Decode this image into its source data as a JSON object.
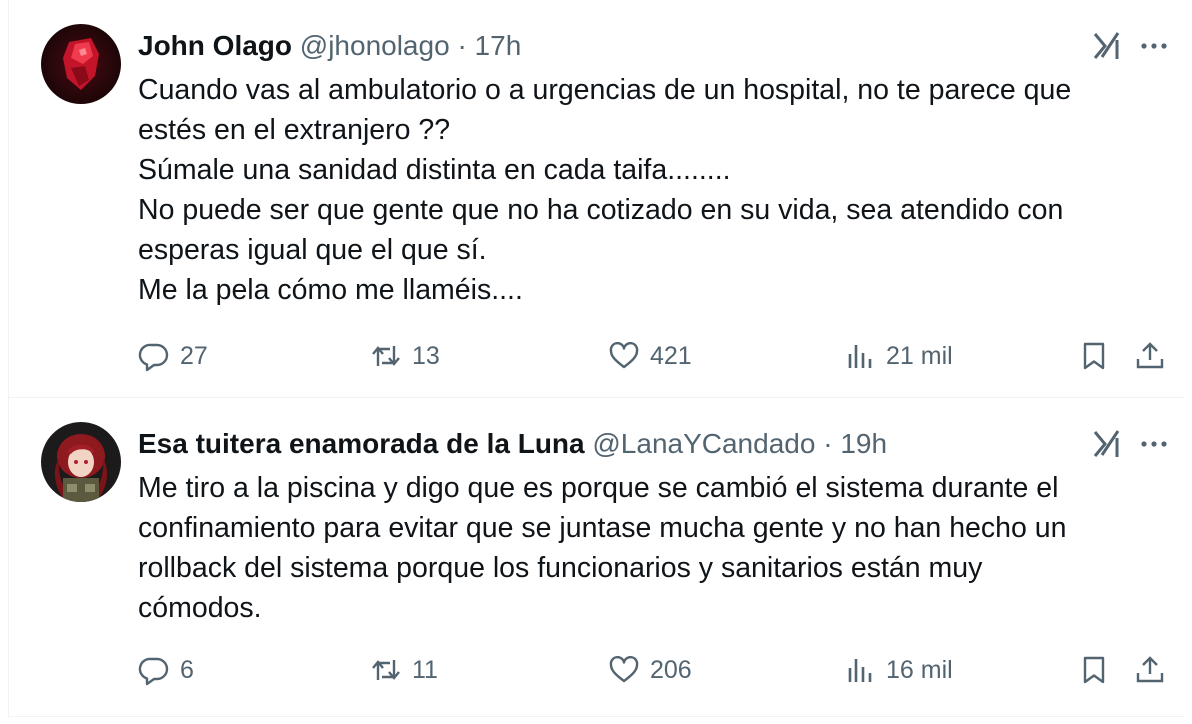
{
  "tweets": [
    {
      "name": "John Olago",
      "handle": "@jhonolago",
      "separator": "·",
      "time": "17h",
      "lines": [
        "Cuando vas al ambulatorio o a urgencias de un hospital, no te parece que",
        "estés en el extranjero ??",
        "Súmale una sanidad distinta en cada taifa........",
        "No puede ser que gente que no ha cotizado en su vida, sea atendido con",
        "esperas igual que el que sí.",
        "Me la pela cómo me llaméis...."
      ],
      "replies": "27",
      "retweets": "13",
      "likes": "421",
      "views": "21 mil"
    },
    {
      "name": "Esa tuitera enamorada de la Luna",
      "handle": "@LanaYCandado",
      "separator": "·",
      "time": "19h",
      "lines": [
        "Me tiro a la piscina y digo que es porque se cambió el sistema durante el",
        "confinamiento para evitar que se juntase mucha gente y no han hecho un",
        "rollback del sistema porque los funcionarios y sanitarios están muy",
        "cómodos."
      ],
      "replies": "6",
      "retweets": "11",
      "likes": "206",
      "views": "16 mil"
    }
  ],
  "icons": {
    "avatar_1": "red-crystal-avatar",
    "avatar_2": "anime-girl-avatar",
    "grok": "grok-icon",
    "more": "more-icon",
    "reply": "reply-icon",
    "retweet": "retweet-icon",
    "like": "like-icon",
    "views": "views-icon",
    "bookmark": "bookmark-icon",
    "share": "share-icon"
  },
  "colors": {
    "text": "#0f1419",
    "secondary": "#536471",
    "border": "#eff3f4"
  }
}
